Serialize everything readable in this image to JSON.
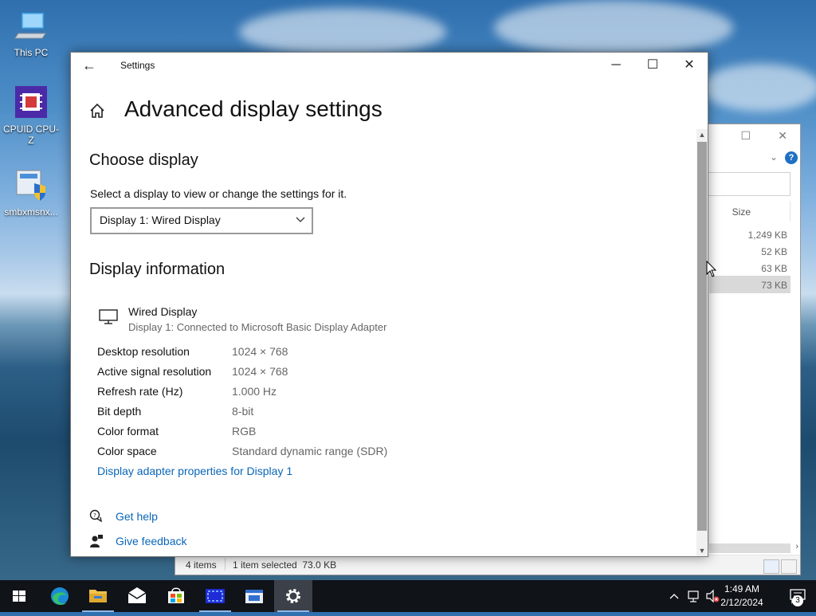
{
  "desktop": {
    "icons": [
      {
        "label": "This PC"
      },
      {
        "label": "CPUID CPU-Z"
      },
      {
        "label": "smbxmsnx..."
      }
    ]
  },
  "explorer": {
    "column_size": "Size",
    "sizes": [
      "1,249 KB",
      "52 KB",
      "63 KB",
      "73 KB"
    ],
    "status_items": "4 items",
    "status_selected": "1 item selected  73.0 KB",
    "help_label": "?"
  },
  "settings": {
    "app_title": "Settings",
    "page_title": "Advanced display settings",
    "choose_display_heading": "Choose display",
    "choose_display_label": "Select a display to view or change the settings for it.",
    "display_selected": "Display 1: Wired Display",
    "display_info_heading": "Display information",
    "display_name": "Wired Display",
    "display_sub": "Display 1: Connected to Microsoft Basic Display Adapter",
    "info": [
      {
        "key": "Desktop resolution",
        "value": "1024 × 768"
      },
      {
        "key": "Active signal resolution",
        "value": "1024 × 768"
      },
      {
        "key": "Refresh rate (Hz)",
        "value": "1.000 Hz"
      },
      {
        "key": "Bit depth",
        "value": "8-bit"
      },
      {
        "key": "Color format",
        "value": "RGB"
      },
      {
        "key": "Color space",
        "value": "Standard dynamic range (SDR)"
      }
    ],
    "adapter_link": "Display adapter properties for Display 1",
    "get_help": "Get help",
    "give_feedback": "Give feedback"
  },
  "taskbar": {
    "time": "1:49 AM",
    "date": "2/12/2024",
    "notification_count": "3",
    "accent": "#8fb8e6"
  }
}
